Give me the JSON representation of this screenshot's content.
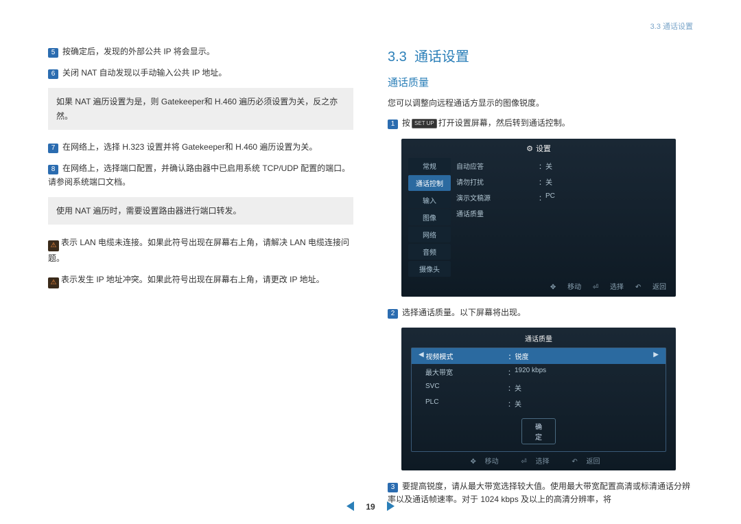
{
  "header": {
    "breadcrumb": "3.3 通话设置"
  },
  "left": {
    "steps": [
      {
        "n": "5",
        "text": "按确定后，发现的外部公共 IP 将会显示。"
      },
      {
        "n": "6",
        "text": "关闭 NAT 自动发现以手动输入公共 IP 地址。"
      }
    ],
    "box1": "如果 NAT 遍历设置为是，则 Gatekeeper和 H.460 遍历必须设置为关，反之亦然。",
    "steps2": [
      {
        "n": "7",
        "text": "在网络上，选择 H.323 设置并将 Gatekeeper和 H.460 遍历设置为关。"
      },
      {
        "n": "8",
        "text": "在网络上，选择端口配置，并确认路由器中已启用系统 TCP/UDP 配置的端口。请参阅系统端口文档。"
      }
    ],
    "box2": "使用 NAT 遍历时，需要设置路由器进行端口转发。",
    "icon1_text": "表示 LAN 电缆未连接。如果此符号出现在屏幕右上角，请解决 LAN 电缆连接问题。",
    "icon2_text": "表示发生 IP 地址冲突。如果此符号出现在屏幕右上角，请更改 IP 地址。",
    "icon1_glyph": "⚠",
    "icon2_glyph": "⚠"
  },
  "right": {
    "section_no": "3.3",
    "section_title": "通话设置",
    "subtitle": "通话质量",
    "intro": "您可以调整向远程通话方显示的图像锐度。",
    "step1_n": "1",
    "step1_a": "按",
    "setup_key": "SET UP",
    "step1_b": "打开设置屏幕，然后转到通话控制。",
    "ss1": {
      "title_icon": "⚙",
      "title": "设置",
      "tabs": [
        "常规",
        "通话控制",
        "输入",
        "图像",
        "网络",
        "音频",
        "摄像头"
      ],
      "active_tab_index": 1,
      "rows": [
        {
          "k": "自动应答",
          "v": "关"
        },
        {
          "k": "请勿打扰",
          "v": "关"
        },
        {
          "k": "演示文稿源",
          "v": "PC"
        },
        {
          "k": "通话质量",
          "v": ""
        }
      ],
      "footer": {
        "move": "移动",
        "select": "选择",
        "back": "返回"
      }
    },
    "step2_n": "2",
    "step2_text": "选择通话质量。以下屏幕将出现。",
    "ss2": {
      "title": "通话质量",
      "rows": [
        {
          "k": "视频模式",
          "v": "锐度",
          "active": true
        },
        {
          "k": "最大带宽",
          "v": "1920 kbps"
        },
        {
          "k": "SVC",
          "v": "关"
        },
        {
          "k": "PLC",
          "v": "关"
        }
      ],
      "confirm": "确定",
      "footer": {
        "move": "移动",
        "select": "选择",
        "back": "返回"
      }
    },
    "step3_n": "3",
    "step3_text": "要提高锐度，请从最大带宽选择较大值。使用最大带宽配置高清或标清通话分辨率以及通话帧速率。对于 1024 kbps 及以上的高清分辨率，将"
  },
  "nav": {
    "page": "19"
  }
}
